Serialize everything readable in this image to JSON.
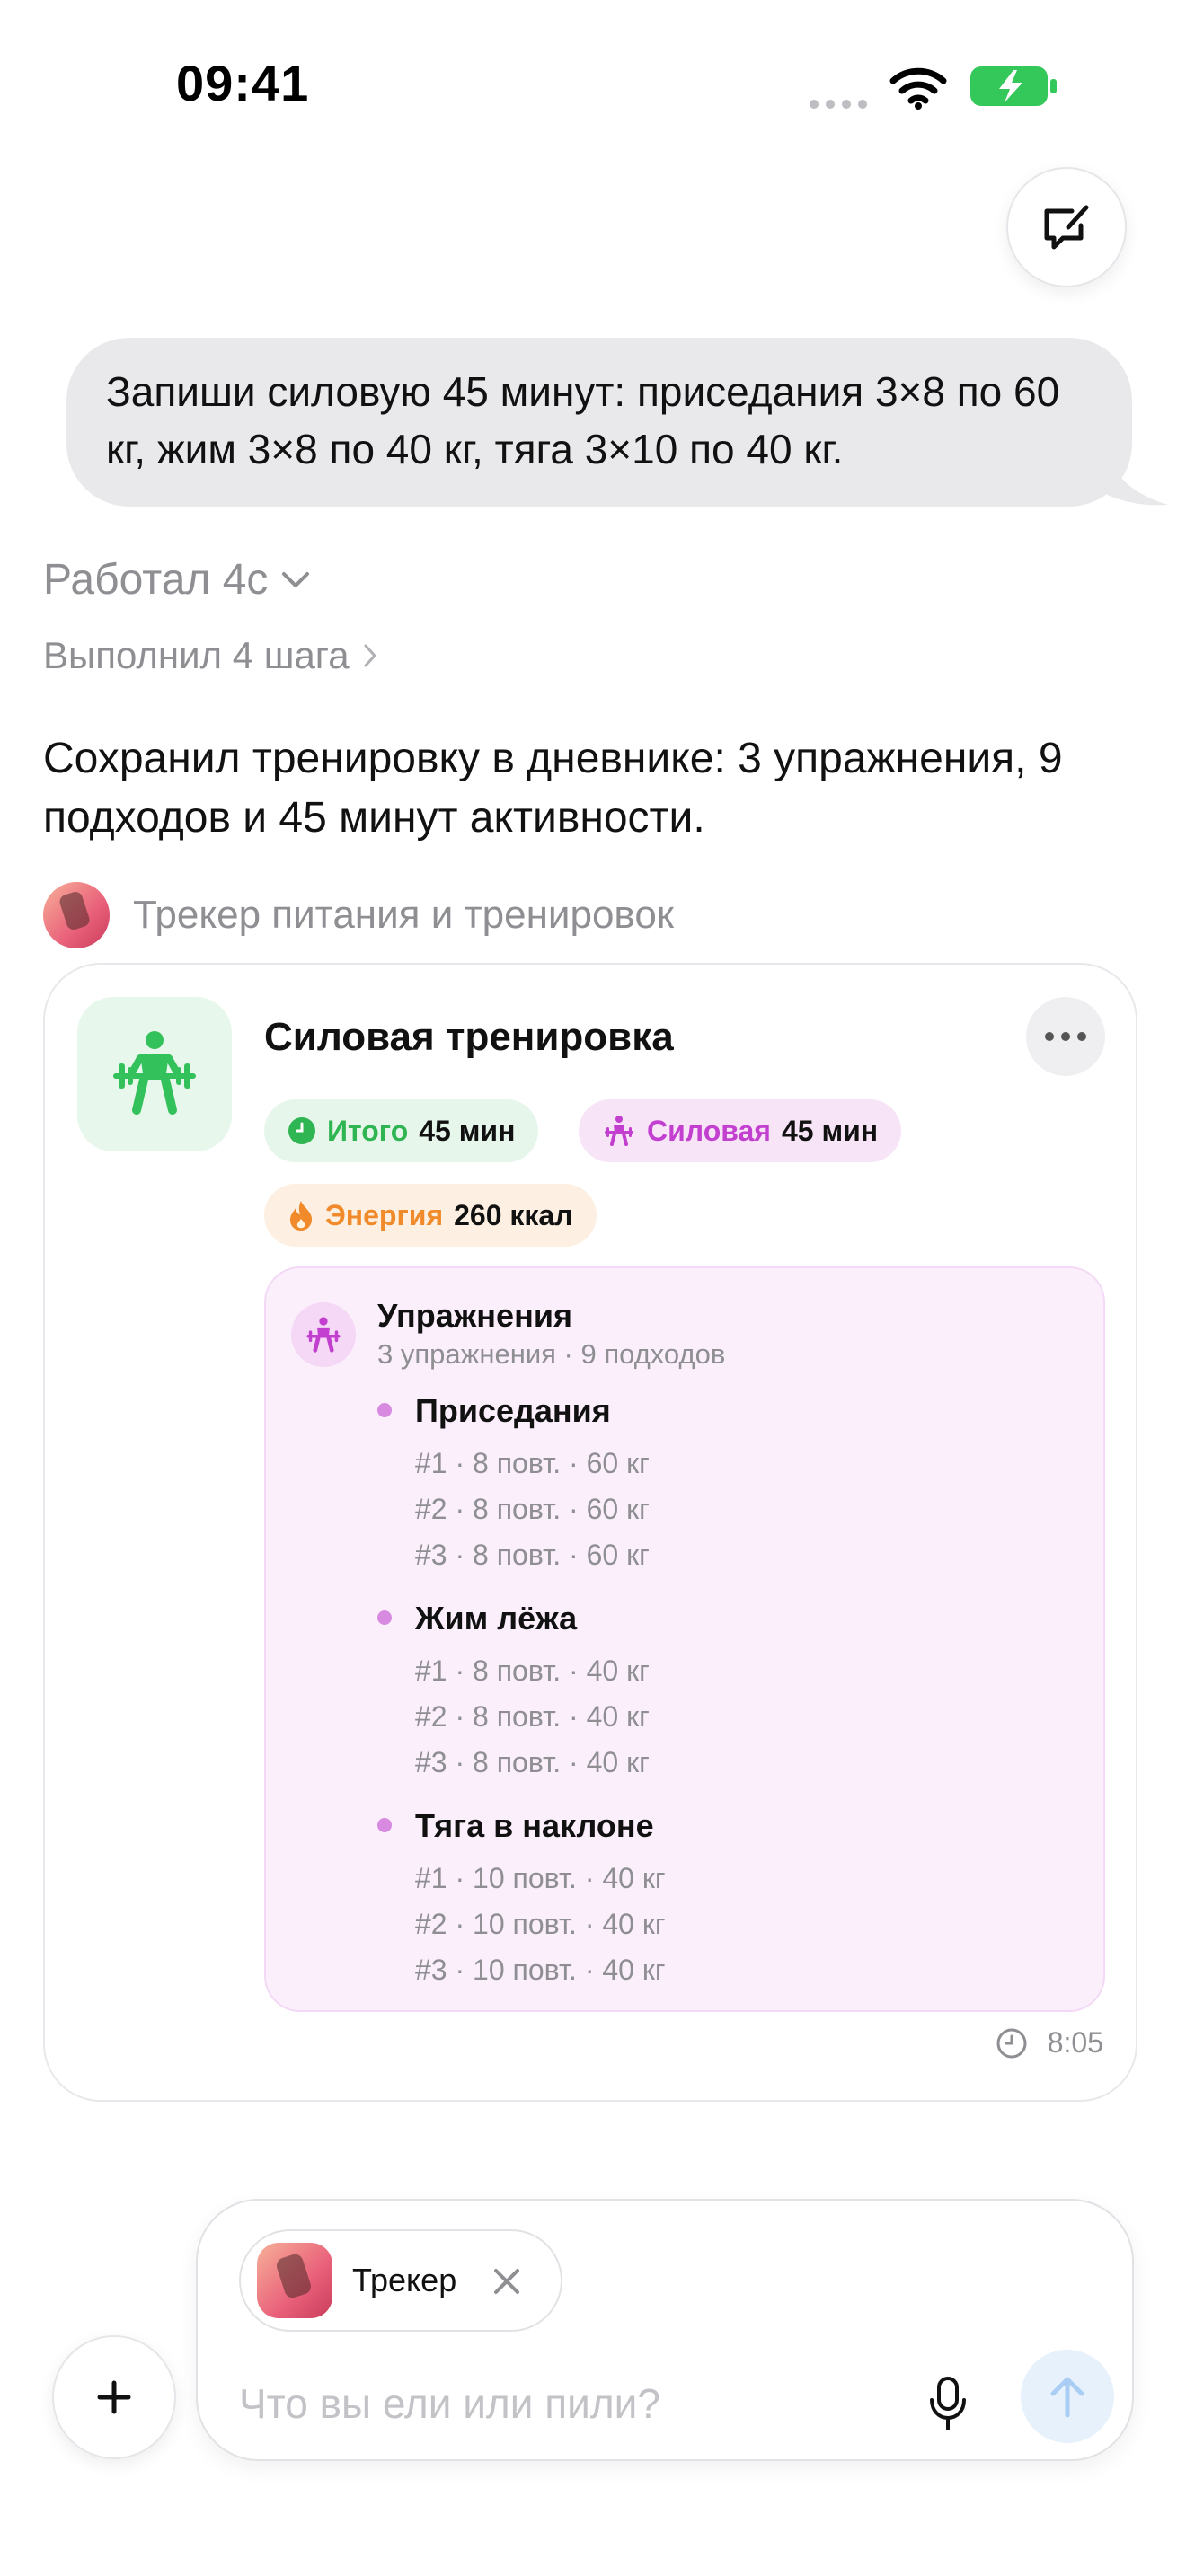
{
  "status_bar": {
    "time": "09:41"
  },
  "user_message": "Запиши силовую 45 минут: приседания 3×8 по 60 кг, жим 3×8 по 40 кг, тяга 3×10 по 40 кг.",
  "thinking": {
    "worked": "Работал 4с",
    "steps": "Выполнил 4 шага"
  },
  "assistant_message": "Сохранил тренировку в дневнике: 3 упражнения, 9 подходов и 45 минут активности.",
  "app": {
    "name": "Трекер питания и тренировок"
  },
  "card": {
    "title": "Силовая тренировка",
    "chips": {
      "total": {
        "label": "Итого",
        "value": "45 мин"
      },
      "strength": {
        "label": "Силовая",
        "value": "45 мин"
      },
      "energy": {
        "label": "Энергия",
        "value": "260 ккал"
      }
    },
    "exercises": {
      "title": "Упражнения",
      "subtitle": "3 упражнения · 9 подходов",
      "items": [
        {
          "name": "Приседания",
          "sets": [
            "#1 · 8 повт. · 60 кг",
            "#2 · 8 повт. · 60 кг",
            "#3 · 8 повт. · 60 кг"
          ]
        },
        {
          "name": "Жим лёжа",
          "sets": [
            "#1 · 8 повт. · 40 кг",
            "#2 · 8 повт. · 40 кг",
            "#3 · 8 повт. · 40 кг"
          ]
        },
        {
          "name": "Тяга в наклоне",
          "sets": [
            "#1 · 10 повт. · 40 кг",
            "#2 · 10 повт. · 40 кг",
            "#3 · 10 повт. · 40 кг"
          ]
        }
      ]
    },
    "time": "8:05"
  },
  "composer": {
    "tracker_chip": "Трекер",
    "placeholder": "Что вы ели или пили?"
  },
  "colors": {
    "accent_green": "#2fb552",
    "accent_magenta": "#c23fcf",
    "accent_orange": "#f08a2a",
    "bubble_gray": "#e9e9ec"
  }
}
